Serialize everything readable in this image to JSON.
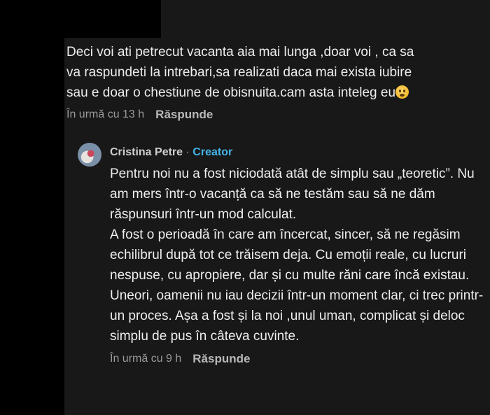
{
  "comment": {
    "lines": [
      "Deci voi ati petrecut vacanta aia mai lunga ,doar voi , ca sa",
      "va raspundeti la intrebari,sa realizati daca mai exista iubire",
      "sau e doar o chestiune de obisnuita.cam asta inteleg eu"
    ],
    "emoji": "thinking-face-emoji",
    "time": "În urmă cu 13 h",
    "reply_label": "Răspunde"
  },
  "reply": {
    "author": "Cristina Petre",
    "separator": "·",
    "badge": "Creator",
    "badge_color": "#43b4e6",
    "paragraphs": [
      "Pentru noi nu a fost niciodată atât de simplu sau „teoretic”. Nu am mers într-o vacanță ca să ne testăm sau să ne dăm răspunsuri într-un mod calculat.",
      "A fost o perioadă în care am încercat, sincer, să ne regăsim echilibrul după tot ce trăisem deja. Cu emoții reale, cu lucruri nespuse, cu apropiere, dar și cu multe răni care încă existau.",
      "Uneori, oamenii nu iau decizii într-un moment clar, ci trec printr-un proces. Așa a fost și la noi ,unul uman, complicat și deloc simplu de pus în câteva cuvinte."
    ],
    "time": "În urmă cu 9 h",
    "reply_label": "Răspunde"
  }
}
